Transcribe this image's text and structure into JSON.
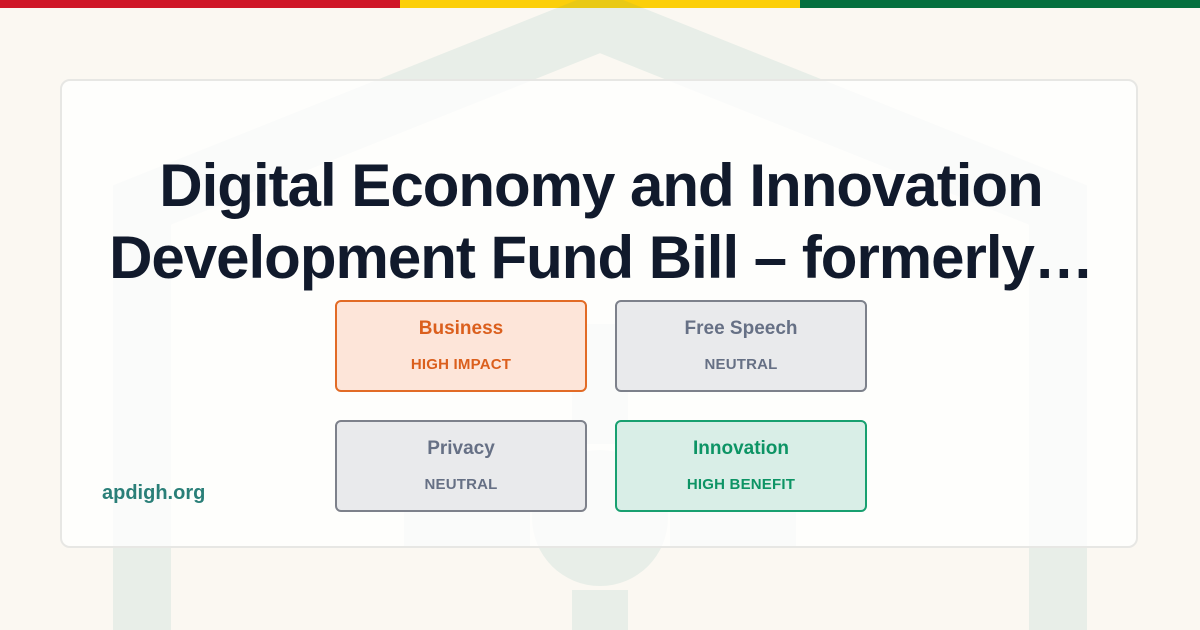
{
  "title": "Digital Economy and Innovation Development Fund Bill – formerly…",
  "site": "apdigh.org",
  "colors": {
    "flag_red": "#cf1728",
    "flag_yellow": "#fccf0a",
    "flag_green": "#05703f",
    "watermark": "#2f8b83",
    "title": "#111a2c",
    "domain": "#2a7f78"
  },
  "impacts": [
    {
      "label": "Business",
      "status": "HIGH IMPACT",
      "text_color": "#db5f1d",
      "fill": "#fde5d9",
      "border": "#e26b26"
    },
    {
      "label": "Free Speech",
      "status": "NEUTRAL",
      "text_color": "#667085",
      "fill": "#e9eaec",
      "border": "#7d818b"
    },
    {
      "label": "Privacy",
      "status": "NEUTRAL",
      "text_color": "#667085",
      "fill": "#e9eaec",
      "border": "#7d818b"
    },
    {
      "label": "Innovation",
      "status": "HIGH BENEFIT",
      "text_color": "#0d9465",
      "fill": "#d9eee7",
      "border": "#18a070"
    }
  ]
}
